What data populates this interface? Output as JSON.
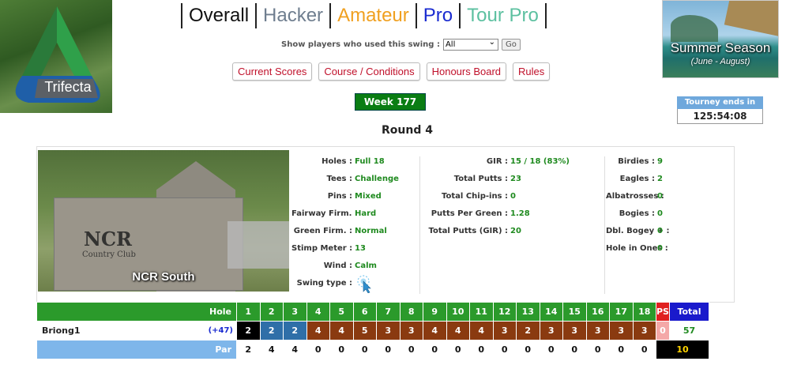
{
  "logo": {
    "text": "Trifecta"
  },
  "tabs": [
    {
      "label": "Overall"
    },
    {
      "label": "Hacker"
    },
    {
      "label": "Amateur"
    },
    {
      "label": "Pro"
    },
    {
      "label": "Tour Pro"
    }
  ],
  "filter": {
    "label": "Show players who used this swing :",
    "selected": "All",
    "go_label": "Go"
  },
  "buttons": {
    "current_scores": "Current Scores",
    "course_conditions": "Course / Conditions",
    "honours_board": "Honours Board",
    "rules": "Rules"
  },
  "week": "Week 177",
  "round": "Round 4",
  "promo": {
    "title": "Summer Season",
    "subtitle": "(June - August)"
  },
  "tourney": {
    "label": "Tourney ends in",
    "time": "125:54:08"
  },
  "course": {
    "name": "NCR South",
    "sign_text": "NCR",
    "sign_sub": "Country Club"
  },
  "conditions": [
    {
      "label": "Holes :",
      "value": "Full 18"
    },
    {
      "label": "Tees :",
      "value": "Challenge"
    },
    {
      "label": "Pins :",
      "value": "Mixed"
    },
    {
      "label": "Fairway Firm. :",
      "value": "Hard"
    },
    {
      "label": "Green Firm. :",
      "value": "Normal"
    },
    {
      "label": "Stimp Meter :",
      "value": "13"
    },
    {
      "label": "Wind :",
      "value": "Calm"
    },
    {
      "label": "Swing type :",
      "icon": "pointer-click-icon"
    }
  ],
  "putting": [
    {
      "label": "GIR :",
      "value": "15 / 18 (83%)"
    },
    {
      "label": "Total Putts :",
      "value": "23"
    },
    {
      "label": "Total Chip-ins :",
      "value": "0"
    },
    {
      "label": "Putts Per Green :",
      "value": "1.28"
    },
    {
      "label": "Total Putts (GIR) :",
      "value": "20"
    }
  ],
  "scoring": [
    {
      "label": "Birdies :",
      "value": "9"
    },
    {
      "label": "Eagles :",
      "value": "2"
    },
    {
      "label": "Albatrosses :",
      "value": "0"
    },
    {
      "label": "Bogies :",
      "value": "0"
    },
    {
      "label": "Dbl. Bogey + :",
      "value": "0"
    },
    {
      "label": "Hole in Ones :",
      "value": "0"
    }
  ],
  "scorecard": {
    "hole_label": "Hole",
    "holes": [
      "1",
      "2",
      "3",
      "4",
      "5",
      "6",
      "7",
      "8",
      "9",
      "10",
      "11",
      "12",
      "13",
      "14",
      "15",
      "16",
      "17",
      "18"
    ],
    "ps_label": "PS",
    "total_label": "Total",
    "player": {
      "name": "Briong1",
      "diff": "(+47)",
      "scores": [
        "2",
        "2",
        "2",
        "4",
        "4",
        "5",
        "3",
        "3",
        "4",
        "4",
        "4",
        "3",
        "2",
        "3",
        "3",
        "3",
        "3",
        "3"
      ],
      "score_types": [
        "eagle",
        "birdie",
        "birdie",
        "bogey",
        "bogey",
        "bogey",
        "bogey",
        "bogey",
        "bogey",
        "bogey",
        "bogey",
        "bogey",
        "bogey",
        "bogey",
        "bogey",
        "bogey",
        "bogey",
        "bogey"
      ],
      "ps": "0",
      "total": "57"
    },
    "par_label": "Par",
    "par": [
      "2",
      "4",
      "4",
      "0",
      "0",
      "0",
      "0",
      "0",
      "0",
      "0",
      "0",
      "0",
      "0",
      "0",
      "0",
      "0",
      "0",
      "0"
    ],
    "par_total": "10"
  },
  "colors": {
    "header_green": "#2b9a2b",
    "eagle": "#000000",
    "birdie": "#2f6fa8",
    "score_brown": "#8a3a10",
    "ps_red": "#e02020",
    "total_blue": "#1a1acc",
    "par_blue": "#7eb6ea",
    "value_green": "#1f8a1f"
  }
}
